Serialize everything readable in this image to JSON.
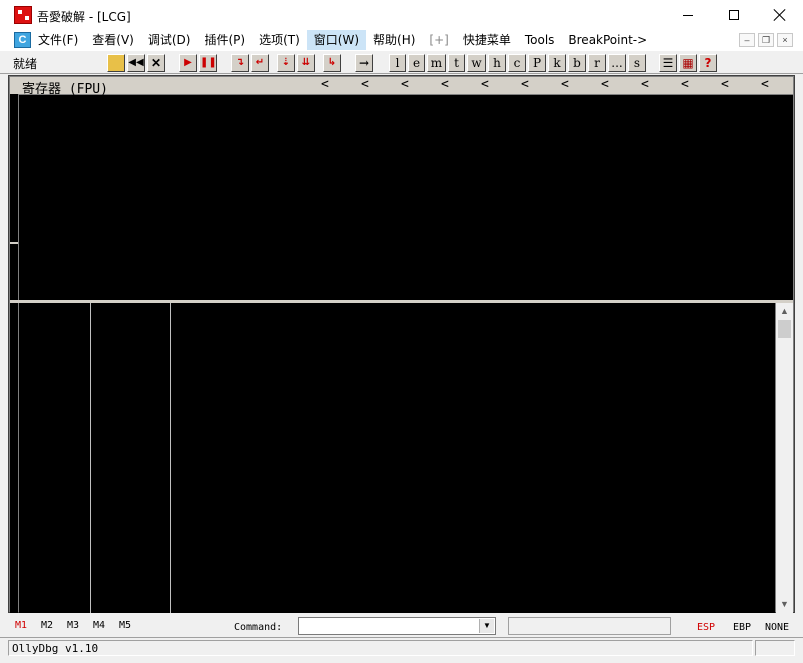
{
  "window": {
    "title": "吾愛破解 - [LCG]"
  },
  "menu": {
    "items": [
      "文件(F)",
      "查看(V)",
      "调试(D)",
      "插件(P)",
      "选项(T)",
      "窗口(W)",
      "帮助(H)",
      "[+]",
      "快捷菜单",
      "Tools",
      "BreakPoint->"
    ],
    "active_index": 5
  },
  "mdi": {
    "min": "–",
    "restore": "❐",
    "close": "×"
  },
  "toolbar": {
    "status": "就绪",
    "letter_buttons": [
      "l",
      "e",
      "m",
      "t",
      "w",
      "h",
      "c",
      "P",
      "k",
      "b",
      "r",
      "...",
      "s"
    ]
  },
  "registers": {
    "title": "寄存器 (FPU)",
    "arrows": [
      "<",
      "<",
      "<",
      "<",
      "<",
      "<",
      "<",
      "<",
      "<",
      "<",
      "<",
      "<"
    ]
  },
  "command_bar": {
    "m_buttons": [
      "M1",
      "M2",
      "M3",
      "M4",
      "M5"
    ],
    "m_active": "M1",
    "command_label": "Command:",
    "command_value": "",
    "reg_buttons": [
      "ESP",
      "EBP",
      "NONE"
    ],
    "reg_active": "ESP"
  },
  "statusbar": {
    "text": "OllyDbg v1.10"
  },
  "colors": {
    "pane_bg": "#000000",
    "accent_red": "#d00000",
    "menu_active": "#cce4f7"
  }
}
